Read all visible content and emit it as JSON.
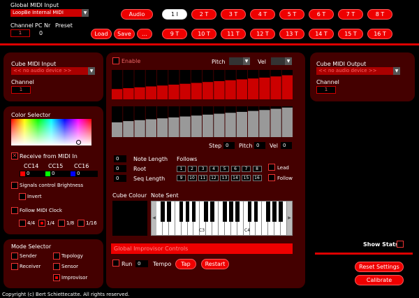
{
  "global_midi": {
    "title": "Global MIDI Input",
    "device": "LoopBe Internal MIDI",
    "channel_label": "Channel",
    "pc_label": "PC Nr",
    "preset_label": "Preset",
    "channel_value": "1",
    "pc_value": "0"
  },
  "toolbar": {
    "audio": "Audio",
    "load": "Load",
    "save": "Save",
    "more": "..."
  },
  "pads": [
    "1 I",
    "2 T",
    "3 T",
    "4 T",
    "5 T",
    "6 T",
    "7 T",
    "8 T",
    "9 T",
    "10 T",
    "11 T",
    "12 T",
    "13 T",
    "14 T",
    "15 T",
    "16 T"
  ],
  "cube_input": {
    "title": "Cube MIDI Input",
    "device": "<< no audio device >>",
    "channel_label": "Channel",
    "channel_value": "1"
  },
  "cube_output": {
    "title": "Cube MIDI Output",
    "device": "<< no audio device >>",
    "channel_label": "Channel",
    "channel_value": "1"
  },
  "color_selector": {
    "title": "Color Selector",
    "receive_label": "Receive from MIDI In",
    "cc14_label": "CC14",
    "cc15_label": "CC15",
    "cc16_label": "CC16",
    "cc14_value": "0",
    "cc15_value": "0",
    "cc16_value": "0",
    "cc14_color": "#ff0000",
    "cc15_color": "#00ff00",
    "cc16_color": "#0000ff",
    "signals_label": "Signals control Brightness",
    "invert_label": "Invert",
    "follow_clock_label": "Follow MIDI Clock",
    "clock_options": [
      "4/4",
      "1/4",
      "1/8",
      "1/16"
    ]
  },
  "mode_selector": {
    "title": "Mode Selector",
    "sender": "Sender",
    "topology": "Topology",
    "receiver": "Receiver",
    "sensor": "Sensor",
    "improvisor": "Improvisor"
  },
  "sequencer": {
    "enable_label": "Enable",
    "pitch_label": "Pitch",
    "vel_label": "Vel",
    "step_label": "Step",
    "step_value": "0",
    "pitch2_label": "Pitch",
    "pitch2_value": "0",
    "vel2_label": "Vel",
    "vel2_value": "0",
    "note_length_label": "Note Length",
    "note_length_value": "0",
    "root_label": "Root",
    "root_value": "0",
    "seq_length_label": "Seq Length",
    "seq_length_value": "0",
    "follows_label": "Follows",
    "follows_row1": [
      "1",
      "2",
      "3",
      "4",
      "5",
      "6",
      "7",
      "8"
    ],
    "follows_row2": [
      "9",
      "10",
      "11",
      "12",
      "13",
      "14",
      "15",
      "16"
    ],
    "lead_label": "Lead",
    "follow_label": "Follow",
    "cube_colour_label": "Cube Colour",
    "note_sent_label": "Note Sent",
    "octave_c3": "C3",
    "octave_c4": "C4",
    "pitch_levels": [
      0.35,
      0.38,
      0.41,
      0.44,
      0.47,
      0.5,
      0.53,
      0.56,
      0.59,
      0.62,
      0.65,
      0.68,
      0.71,
      0.74,
      0.78,
      0.82
    ],
    "vel_levels": [
      0.48,
      0.52,
      0.55,
      0.58,
      0.61,
      0.64,
      0.67,
      0.7,
      0.73,
      0.76,
      0.79,
      0.82,
      0.85,
      0.88,
      0.92,
      0.96
    ]
  },
  "improvisor": {
    "title": "Global Improvisor Controls",
    "run_label": "Run",
    "tempo_value": "0",
    "tempo_label": "Tempo",
    "tap": "Tap",
    "restart": "Restart"
  },
  "right": {
    "show_stats": "Show Stats",
    "reset": "Reset Settings",
    "calibrate": "Calibrate"
  },
  "footer": {
    "copyright": "Copyright (c) Bert Schiettecatte. All rights reserved."
  }
}
